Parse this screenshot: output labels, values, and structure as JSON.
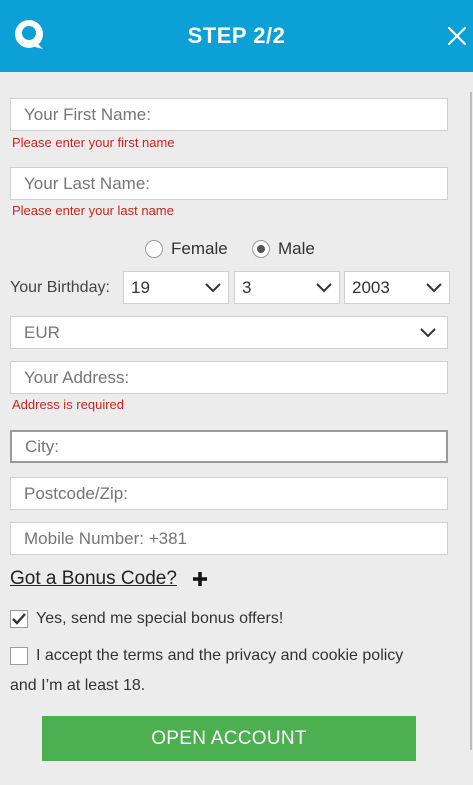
{
  "header": {
    "title": "STEP 2/2",
    "logo_icon": "chat-bubble-logo",
    "close_icon": "close-x",
    "bg": "#0ba0d6"
  },
  "form": {
    "first_name": {
      "placeholder": "Your First Name:",
      "value": "",
      "error": "Please enter your first name"
    },
    "last_name": {
      "placeholder": "Your Last Name:",
      "value": "",
      "error": "Please enter your last name"
    },
    "gender": {
      "options": [
        "Female",
        "Male"
      ],
      "selected": "Male"
    },
    "birthday": {
      "label": "Your Birthday:",
      "day": "19",
      "month": "3",
      "year": "2003"
    },
    "currency": {
      "value": "EUR"
    },
    "address": {
      "placeholder": "Your Address:",
      "value": "",
      "error": "Address is required"
    },
    "city": {
      "placeholder": "City:",
      "value": ""
    },
    "postcode": {
      "placeholder": "Postcode/Zip:",
      "value": ""
    },
    "mobile": {
      "placeholder": "Mobile Number: +381",
      "value": ""
    },
    "bonus_code": {
      "label": "Got a Bonus Code?"
    },
    "offers": {
      "label": "Yes, send me special bonus offers!",
      "checked": true
    },
    "terms": {
      "label_line1": "I accept the terms and the privacy and cookie policy",
      "label_line2": "and I’m at least 18.",
      "checked": false
    },
    "submit_label": "OPEN ACCOUNT",
    "submit_color": "#4caf50",
    "error_color": "#c8261d"
  }
}
